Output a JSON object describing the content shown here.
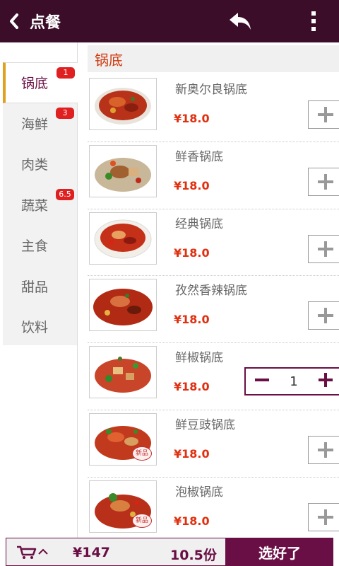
{
  "header": {
    "title": "点餐",
    "back_icon": "chevron-left-icon",
    "undo_icon": "undo-arrow-icon",
    "menu_icon": "kebab-menu-icon"
  },
  "sidebar": {
    "items": [
      {
        "label": "锅底",
        "badge": "1",
        "active": true
      },
      {
        "label": "海鲜",
        "badge": "3"
      },
      {
        "label": "肉类"
      },
      {
        "label": "蔬菜",
        "badge": "6.5"
      },
      {
        "label": "主食"
      },
      {
        "label": "甜品"
      },
      {
        "label": "饮料"
      }
    ]
  },
  "section": {
    "title": "锅底"
  },
  "items": [
    {
      "name": "新奥尔良锅底",
      "price": "¥18.0"
    },
    {
      "name": "鲜香锅底",
      "price": "¥18.0"
    },
    {
      "name": "经典锅底",
      "price": "¥18.0"
    },
    {
      "name": "孜然香辣锅底",
      "price": "¥18.0"
    },
    {
      "name": "鲜椒锅底",
      "price": "¥18.0",
      "quantity": "1"
    },
    {
      "name": "鲜豆豉锅底",
      "price": "¥18.0",
      "tag": "新品"
    },
    {
      "name": "泡椒锅底",
      "price": "¥18.0",
      "tag": "新品"
    }
  ],
  "footer": {
    "cart_icon": "cart-icon",
    "total": "¥147",
    "count": "10.5份",
    "done_label": "选好了"
  },
  "colors": {
    "topbar": "#3b0d28",
    "accent": "#6a0f45",
    "price": "#e03010",
    "badge": "#e02020",
    "active_marker": "#e0a020"
  }
}
